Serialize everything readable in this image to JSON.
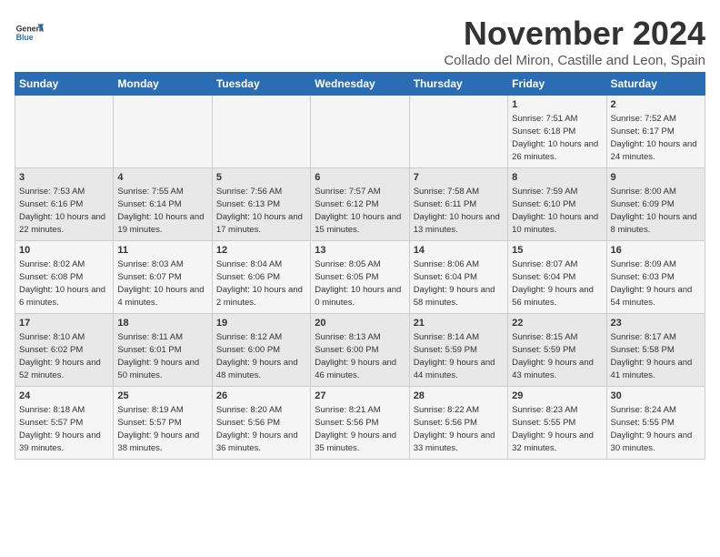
{
  "header": {
    "logo_line1": "General",
    "logo_line2": "Blue",
    "title": "November 2024",
    "subtitle": "Collado del Miron, Castille and Leon, Spain"
  },
  "weekdays": [
    "Sunday",
    "Monday",
    "Tuesday",
    "Wednesday",
    "Thursday",
    "Friday",
    "Saturday"
  ],
  "weeks": [
    [
      {
        "day": "",
        "info": ""
      },
      {
        "day": "",
        "info": ""
      },
      {
        "day": "",
        "info": ""
      },
      {
        "day": "",
        "info": ""
      },
      {
        "day": "",
        "info": ""
      },
      {
        "day": "1",
        "info": "Sunrise: 7:51 AM\nSunset: 6:18 PM\nDaylight: 10 hours and 26 minutes."
      },
      {
        "day": "2",
        "info": "Sunrise: 7:52 AM\nSunset: 6:17 PM\nDaylight: 10 hours and 24 minutes."
      }
    ],
    [
      {
        "day": "3",
        "info": "Sunrise: 7:53 AM\nSunset: 6:16 PM\nDaylight: 10 hours and 22 minutes."
      },
      {
        "day": "4",
        "info": "Sunrise: 7:55 AM\nSunset: 6:14 PM\nDaylight: 10 hours and 19 minutes."
      },
      {
        "day": "5",
        "info": "Sunrise: 7:56 AM\nSunset: 6:13 PM\nDaylight: 10 hours and 17 minutes."
      },
      {
        "day": "6",
        "info": "Sunrise: 7:57 AM\nSunset: 6:12 PM\nDaylight: 10 hours and 15 minutes."
      },
      {
        "day": "7",
        "info": "Sunrise: 7:58 AM\nSunset: 6:11 PM\nDaylight: 10 hours and 13 minutes."
      },
      {
        "day": "8",
        "info": "Sunrise: 7:59 AM\nSunset: 6:10 PM\nDaylight: 10 hours and 10 minutes."
      },
      {
        "day": "9",
        "info": "Sunrise: 8:00 AM\nSunset: 6:09 PM\nDaylight: 10 hours and 8 minutes."
      }
    ],
    [
      {
        "day": "10",
        "info": "Sunrise: 8:02 AM\nSunset: 6:08 PM\nDaylight: 10 hours and 6 minutes."
      },
      {
        "day": "11",
        "info": "Sunrise: 8:03 AM\nSunset: 6:07 PM\nDaylight: 10 hours and 4 minutes."
      },
      {
        "day": "12",
        "info": "Sunrise: 8:04 AM\nSunset: 6:06 PM\nDaylight: 10 hours and 2 minutes."
      },
      {
        "day": "13",
        "info": "Sunrise: 8:05 AM\nSunset: 6:05 PM\nDaylight: 10 hours and 0 minutes."
      },
      {
        "day": "14",
        "info": "Sunrise: 8:06 AM\nSunset: 6:04 PM\nDaylight: 9 hours and 58 minutes."
      },
      {
        "day": "15",
        "info": "Sunrise: 8:07 AM\nSunset: 6:04 PM\nDaylight: 9 hours and 56 minutes."
      },
      {
        "day": "16",
        "info": "Sunrise: 8:09 AM\nSunset: 6:03 PM\nDaylight: 9 hours and 54 minutes."
      }
    ],
    [
      {
        "day": "17",
        "info": "Sunrise: 8:10 AM\nSunset: 6:02 PM\nDaylight: 9 hours and 52 minutes."
      },
      {
        "day": "18",
        "info": "Sunrise: 8:11 AM\nSunset: 6:01 PM\nDaylight: 9 hours and 50 minutes."
      },
      {
        "day": "19",
        "info": "Sunrise: 8:12 AM\nSunset: 6:00 PM\nDaylight: 9 hours and 48 minutes."
      },
      {
        "day": "20",
        "info": "Sunrise: 8:13 AM\nSunset: 6:00 PM\nDaylight: 9 hours and 46 minutes."
      },
      {
        "day": "21",
        "info": "Sunrise: 8:14 AM\nSunset: 5:59 PM\nDaylight: 9 hours and 44 minutes."
      },
      {
        "day": "22",
        "info": "Sunrise: 8:15 AM\nSunset: 5:59 PM\nDaylight: 9 hours and 43 minutes."
      },
      {
        "day": "23",
        "info": "Sunrise: 8:17 AM\nSunset: 5:58 PM\nDaylight: 9 hours and 41 minutes."
      }
    ],
    [
      {
        "day": "24",
        "info": "Sunrise: 8:18 AM\nSunset: 5:57 PM\nDaylight: 9 hours and 39 minutes."
      },
      {
        "day": "25",
        "info": "Sunrise: 8:19 AM\nSunset: 5:57 PM\nDaylight: 9 hours and 38 minutes."
      },
      {
        "day": "26",
        "info": "Sunrise: 8:20 AM\nSunset: 5:56 PM\nDaylight: 9 hours and 36 minutes."
      },
      {
        "day": "27",
        "info": "Sunrise: 8:21 AM\nSunset: 5:56 PM\nDaylight: 9 hours and 35 minutes."
      },
      {
        "day": "28",
        "info": "Sunrise: 8:22 AM\nSunset: 5:56 PM\nDaylight: 9 hours and 33 minutes."
      },
      {
        "day": "29",
        "info": "Sunrise: 8:23 AM\nSunset: 5:55 PM\nDaylight: 9 hours and 32 minutes."
      },
      {
        "day": "30",
        "info": "Sunrise: 8:24 AM\nSunset: 5:55 PM\nDaylight: 9 hours and 30 minutes."
      }
    ]
  ]
}
